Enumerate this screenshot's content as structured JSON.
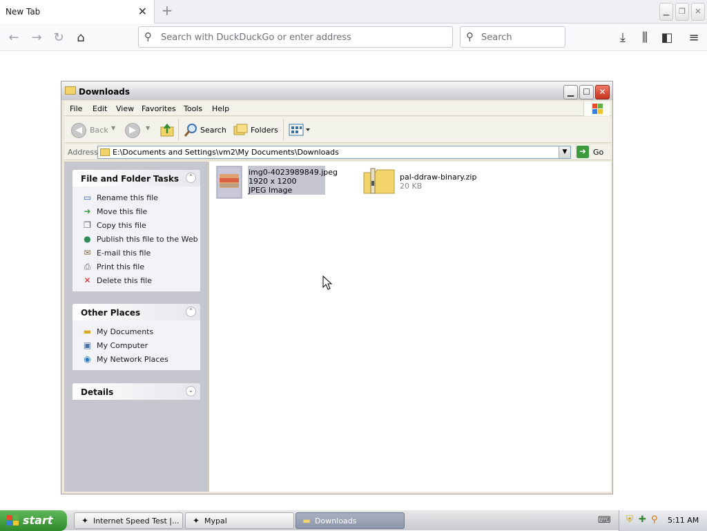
{
  "browser": {
    "tab_title": "New Tab",
    "tab_close": "✕",
    "new_tab": "+",
    "address_placeholder": "Search with DuckDuckGo or enter address",
    "search_placeholder": "Search",
    "nav_icons": [
      "back-icon",
      "forward-icon",
      "reload-icon",
      "home-icon"
    ],
    "toolbar_icons": [
      "downloads-icon",
      "library-icon",
      "sidebar-icon",
      "menu-icon"
    ]
  },
  "window": {
    "title": "Downloads",
    "menu": [
      "File",
      "Edit",
      "View",
      "Favorites",
      "Tools",
      "Help"
    ],
    "toolbar": {
      "back": "Back",
      "search": "Search",
      "folders": "Folders"
    },
    "address": {
      "label": "Address",
      "path": "E:\\Documents and Settings\\vm2\\My Documents\\Downloads",
      "go": "Go"
    },
    "file_tasks": {
      "title": "File and Folder Tasks",
      "items": [
        "Rename this file",
        "Move this file",
        "Copy this file",
        "Publish this file to the Web",
        "E-mail this file",
        "Print this file",
        "Delete this file"
      ]
    },
    "other_places": {
      "title": "Other Places",
      "items": [
        "My Documents",
        "My Computer",
        "My Network Places"
      ]
    },
    "details": {
      "title": "Details"
    },
    "files": [
      {
        "name": "img0-4023989849.jpeg",
        "line2": "1920 x 1200",
        "line3": "JPEG Image",
        "selected": true
      },
      {
        "name": "pal-ddraw-binary.zip",
        "line2": "20 KB",
        "line3": "",
        "selected": false
      }
    ]
  },
  "taskbar": {
    "start": "start",
    "tasks": [
      "Internet Speed Test |...",
      "Mypal",
      "Downloads"
    ],
    "active_task": "Downloads",
    "clock": "5:11 AM"
  }
}
